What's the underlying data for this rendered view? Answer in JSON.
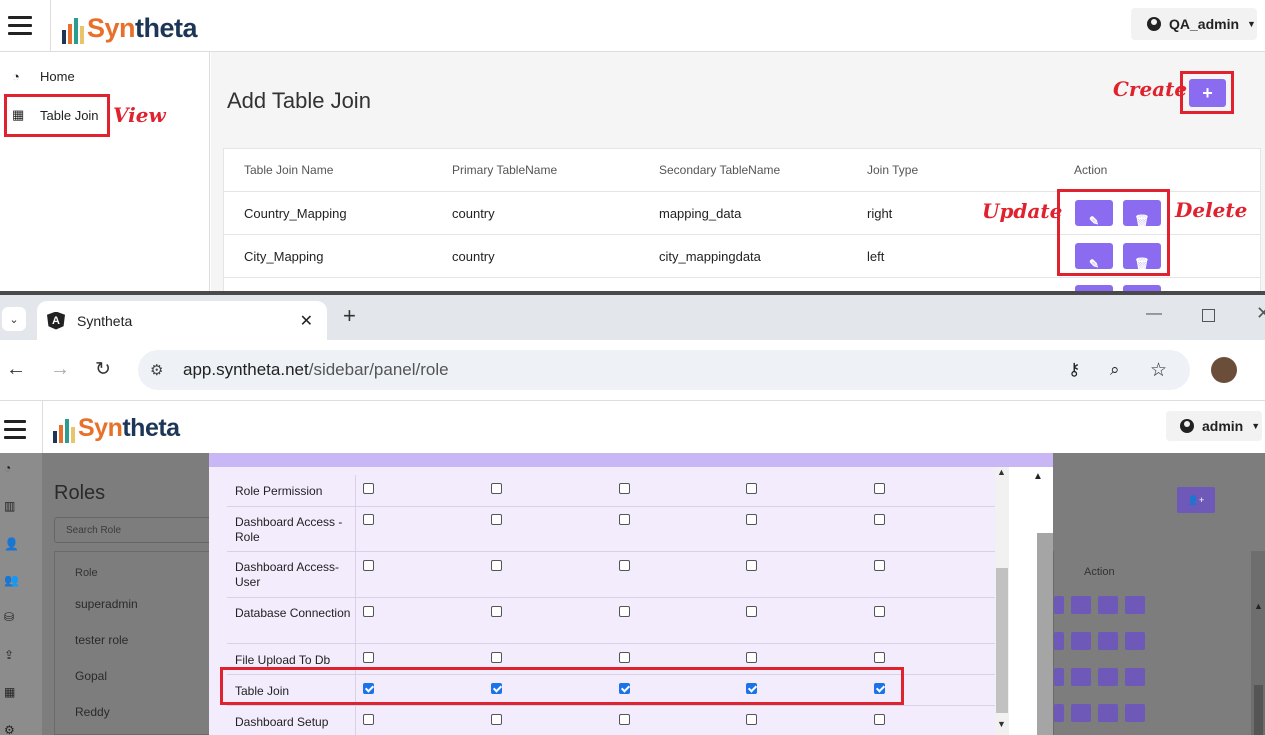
{
  "top": {
    "brand": {
      "part1": "Syn",
      "part2": "theta"
    },
    "user": "QA_admin",
    "nav": [
      {
        "label": "Home",
        "icon": "dashboard-icon"
      },
      {
        "label": "Table Join",
        "icon": "table-icon"
      }
    ],
    "page_title": "Add Table Join",
    "table": {
      "headers": [
        "Table Join Name",
        "Primary TableName",
        "Secondary TableName",
        "Join Type",
        "Action"
      ],
      "rows": [
        [
          "Country_Mapping",
          "country",
          "mapping_data",
          "right"
        ],
        [
          "City_Mapping",
          "country",
          "city_mappingdata",
          "left"
        ]
      ]
    },
    "annotations": {
      "view": "View",
      "create": "Create",
      "update": "Update",
      "delete": "Delete"
    },
    "colors": {
      "accent": "#8b6cf0",
      "annotation": "#e0222e"
    }
  },
  "browser": {
    "tab_title": "Syntheta",
    "url_host": "app.syntheta.net",
    "url_path": "/sidebar/panel/role"
  },
  "app2": {
    "brand": {
      "part1": "Syn",
      "part2": "theta"
    },
    "user": "admin",
    "page_title": "Roles",
    "search_placeholder": "Search Role",
    "role_header": "Role",
    "action_header": "Action",
    "roles": [
      "superadmin",
      "tester role",
      "Gopal",
      "Reddy"
    ],
    "permissions": [
      {
        "label": "Role Permission",
        "checked": [
          false,
          false,
          false,
          false,
          false
        ]
      },
      {
        "label": "Dashboard Access - Role",
        "checked": [
          false,
          false,
          false,
          false,
          false
        ]
      },
      {
        "label": "Dashboard Access- User",
        "checked": [
          false,
          false,
          false,
          false,
          false
        ]
      },
      {
        "label": "Database Connection",
        "checked": [
          false,
          false,
          false,
          false,
          false
        ]
      },
      {
        "label": "File Upload To Db",
        "checked": [
          false,
          false,
          false,
          false,
          false
        ]
      },
      {
        "label": "Table Join",
        "checked": [
          true,
          true,
          true,
          true,
          true
        ]
      },
      {
        "label": "Dashboard Setup",
        "checked": [
          false,
          false,
          false,
          false,
          false
        ]
      }
    ]
  }
}
